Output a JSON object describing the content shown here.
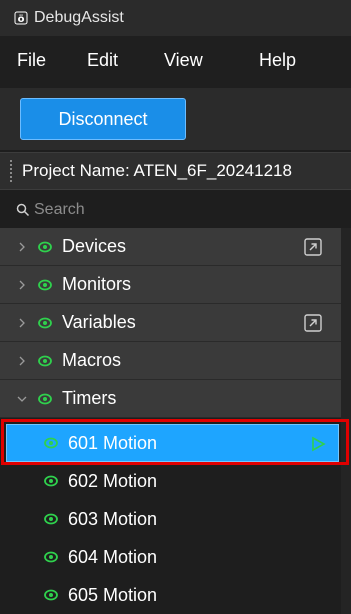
{
  "window": {
    "title": "DebugAssist"
  },
  "menu": {
    "file": "File",
    "edit": "Edit",
    "view": "View",
    "help": "Help"
  },
  "toolbar": {
    "disconnect_label": "Disconnect"
  },
  "project": {
    "label": "Project Name: ATEN_6F_20241218"
  },
  "search": {
    "placeholder": "Search"
  },
  "tree": {
    "groups": [
      {
        "label": "Devices",
        "expanded": false,
        "has_popout": true
      },
      {
        "label": "Monitors",
        "expanded": false,
        "has_popout": false
      },
      {
        "label": "Variables",
        "expanded": false,
        "has_popout": true
      },
      {
        "label": "Macros",
        "expanded": false,
        "has_popout": false
      },
      {
        "label": "Timers",
        "expanded": true,
        "has_popout": false
      }
    ],
    "timers": [
      {
        "label": "601 Motion",
        "selected": true
      },
      {
        "label": "602 Motion",
        "selected": false
      },
      {
        "label": "603 Motion",
        "selected": false
      },
      {
        "label": "604 Motion",
        "selected": false
      },
      {
        "label": "605 Motion",
        "selected": false
      }
    ]
  },
  "colors": {
    "accent": "#1ea5ff",
    "eye_green": "#2fd14d",
    "highlight_red": "#e00000"
  }
}
